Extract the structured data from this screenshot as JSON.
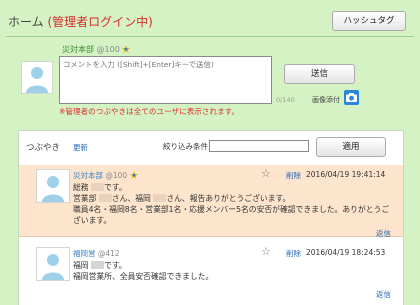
{
  "header": {
    "home_label": "ホーム",
    "admin_label": "(管理者ログイン中)",
    "hashtag_button": "ハッシュタグ"
  },
  "compose": {
    "author_name": "災対本部",
    "author_points": "@100",
    "placeholder": "コメントを入力 ([Shift]+[Enter]キーで送信)",
    "counter": "0/140",
    "send_button": "送信",
    "image_attach_label": "画像添付",
    "admin_notice": "※管理者のつぶやきは全てのユーザに表示されます。"
  },
  "timeline": {
    "title": "つぶやき",
    "refresh_link": "更新",
    "filter_label": "絞り込み条件:",
    "filter_value": "",
    "apply_button": "適用",
    "posts": [
      {
        "author": "災対本部",
        "points": "@100",
        "delete_label": "削除",
        "timestamp": "2016/04/19 19:41:14",
        "line1": "総務",
        "line1_suffix": "です。",
        "line2_a": "営業部",
        "line2_b": "さん、福岡",
        "line2_c": "さん、報告ありがとうございます。",
        "line3": "職員4名・福岡8名・営業部1名・応援メンバー5名の安否が確認できました。ありがとうございます。",
        "reply_label": "返信"
      },
      {
        "author": "福岡営",
        "points": "@412",
        "delete_label": "削除",
        "timestamp": "2016/04/19 18:24:53",
        "line1": "福岡",
        "line1_suffix": "です。",
        "line2": "福岡営業所、全員安否確認できました。",
        "reply_label": "返信"
      }
    ]
  },
  "icons": {
    "badge": "badge-icon",
    "camera": "camera-icon",
    "star": "star-icon",
    "avatar": "user-avatar-icon"
  },
  "colors": {
    "page_bg": "#d4f2c4",
    "admin_red": "#d92b2b",
    "link_blue": "#2a68b8",
    "highlight_post": "#fde4cc"
  }
}
